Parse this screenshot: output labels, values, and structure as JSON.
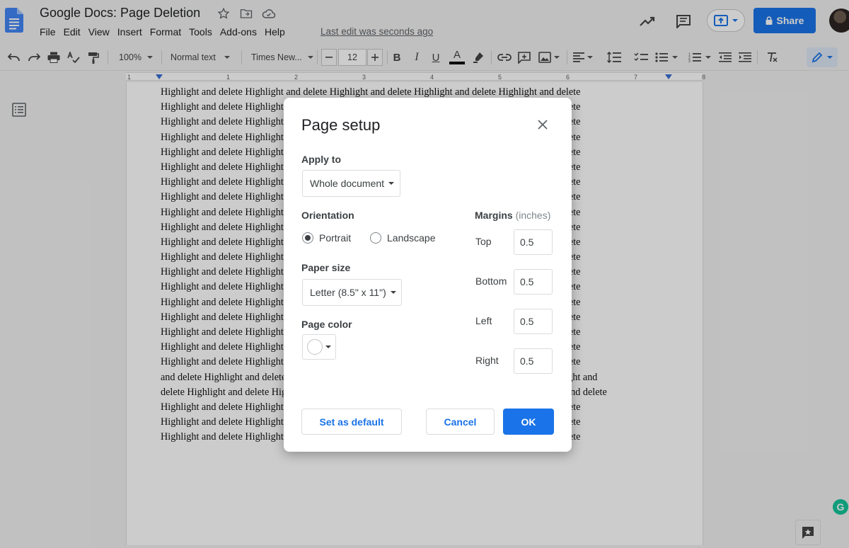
{
  "app": {
    "title": "Google Docs: Page Deletion",
    "last_edit": "Last edit was seconds ago",
    "share_label": "Share"
  },
  "menu": [
    "File",
    "Edit",
    "View",
    "Insert",
    "Format",
    "Tools",
    "Add-ons",
    "Help"
  ],
  "toolbar": {
    "zoom": "100%",
    "style": "Normal text",
    "font": "Times New...",
    "font_size": "12"
  },
  "ruler": {
    "numbers": [
      "1",
      "1",
      "2",
      "3",
      "4",
      "5",
      "6",
      "7",
      "8"
    ]
  },
  "document": {
    "lines": [
      "Highlight and delete Highlight and delete Highlight and delete Highlight and delete Highlight and delete",
      "Highlight and delete Highlight and delete Highlight and delete Highlight and delete Highlight and delete",
      "Highlight and delete Highlight and delete Highlight and delete Highlight and delete Highlight and delete",
      "Highlight and delete Highlight and delete Highlight and delete Highlight and delete Highlight and delete",
      "Highlight and delete Highlight and delete Highlight and delete Highlight and delete Highlight and delete",
      "Highlight and delete Highlight and delete Highlight and delete Highlight and delete Highlight and delete",
      "Highlight and delete Highlight and delete Highlight and delete Highlight and delete Highlight and delete",
      "Highlight and delete Highlight and delete Highlight and delete Highlight and delete Highlight and delete",
      "Highlight and delete Highlight and delete Highlight and delete Highlight and delete Highlight and delete",
      "Highlight and delete Highlight and delete Highlight and delete Highlight and delete Highlight and delete",
      "Highlight and delete Highlight and delete Highlight and delete Highlight and delete Highlight and delete",
      "Highlight and delete Highlight and delete Highlight and delete Highlight and delete Highlight and delete",
      "Highlight and delete Highlight and delete Highlight and delete Highlight and delete Highlight and delete",
      "Highlight and delete Highlight and delete Highlight and delete Highlight and delete Highlight and delete",
      "Highlight and delete Highlight and delete Highlight and delete Highlight and delete Highlight and delete",
      "Highlight and delete Highlight and delete Highlight and delete Highlight and delete Highlight and delete",
      "Highlight and delete Highlight and delete Highlight and delete Highlight and delete Highlight and delete",
      "Highlight and delete Highlight and delete Highlight and delete Highlight and delete Highlight and delete",
      "Highlight and delete Highlight and delete Highlight and delete Highlight and delete Highlight and delete",
      "and delete Highlight and delete Highlight and delete Highlight and delete Highlight and delete Highlight and",
      "delete Highlight and delete Highlight and delete Highlight and delete Highlight and delete Highlight and delete",
      "Highlight and delete Highlight and delete Highlight and delete Highlight and delete Highlight and delete",
      "Highlight and delete Highlight and delete Highlight and delete Highlight and delete Highlight and delete",
      "Highlight and delete Highlight and delete Highlight and delete Highlight and delete Highlight and delete"
    ]
  },
  "dialog": {
    "title": "Page setup",
    "apply_to_label": "Apply to",
    "apply_to_value": "Whole document",
    "orientation_label": "Orientation",
    "portrait_label": "Portrait",
    "landscape_label": "Landscape",
    "orientation_selected": "Portrait",
    "paper_size_label": "Paper size",
    "paper_size_value": "Letter (8.5\" x 11\")",
    "page_color_label": "Page color",
    "page_color_value": "#ffffff",
    "margins_label": "Margins",
    "margins_unit": "(inches)",
    "margins": {
      "top_label": "Top",
      "top": "0.5",
      "bottom_label": "Bottom",
      "bottom": "0.5",
      "left_label": "Left",
      "left": "0.5",
      "right_label": "Right",
      "right": "0.5"
    },
    "set_default_label": "Set as default",
    "cancel_label": "Cancel",
    "ok_label": "OK"
  },
  "colors": {
    "accent": "#1a73e8",
    "docs_blue": "#4285f4"
  }
}
